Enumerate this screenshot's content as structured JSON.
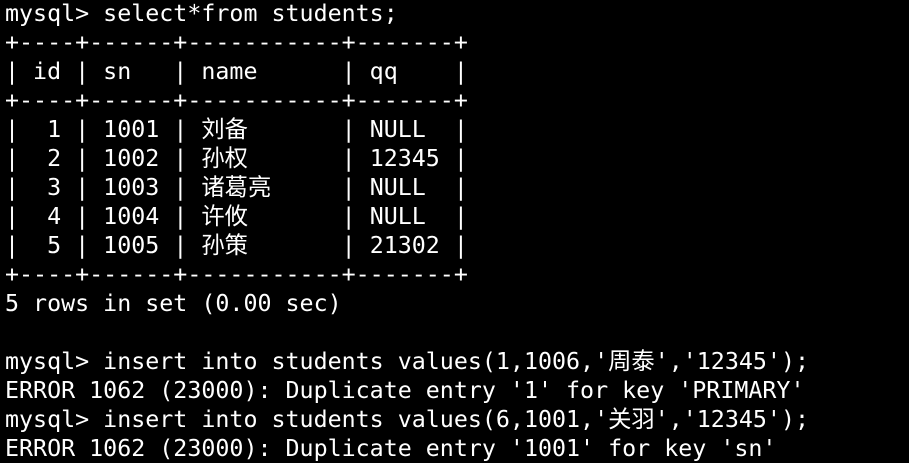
{
  "terminal": {
    "prompt1": "mysql> select*from students;",
    "border": "+----+------+-----------+-------+",
    "header_line": "| id | sn   | name      | qq    |",
    "rows": [
      {
        "id": "1",
        "sn": "1001",
        "name": "刘备",
        "qq": "NULL"
      },
      {
        "id": "2",
        "sn": "1002",
        "name": "孙权",
        "qq": "12345"
      },
      {
        "id": "3",
        "sn": "1003",
        "name": "诸葛亮",
        "qq": "NULL"
      },
      {
        "id": "4",
        "sn": "1004",
        "name": "许攸",
        "qq": "NULL"
      },
      {
        "id": "5",
        "sn": "1005",
        "name": "孙策",
        "qq": "21302"
      }
    ],
    "result_summary": "5 rows in set (0.00 sec)",
    "prompt2": "mysql> insert into students values(1,1006,'周泰','12345');",
    "error1": "ERROR 1062 (23000): Duplicate entry '1' for key 'PRIMARY'",
    "prompt3": "mysql> insert into students values(6,1001,'关羽','12345');",
    "error2": "ERROR 1062 (23000): Duplicate entry '1001' for key 'sn'"
  }
}
